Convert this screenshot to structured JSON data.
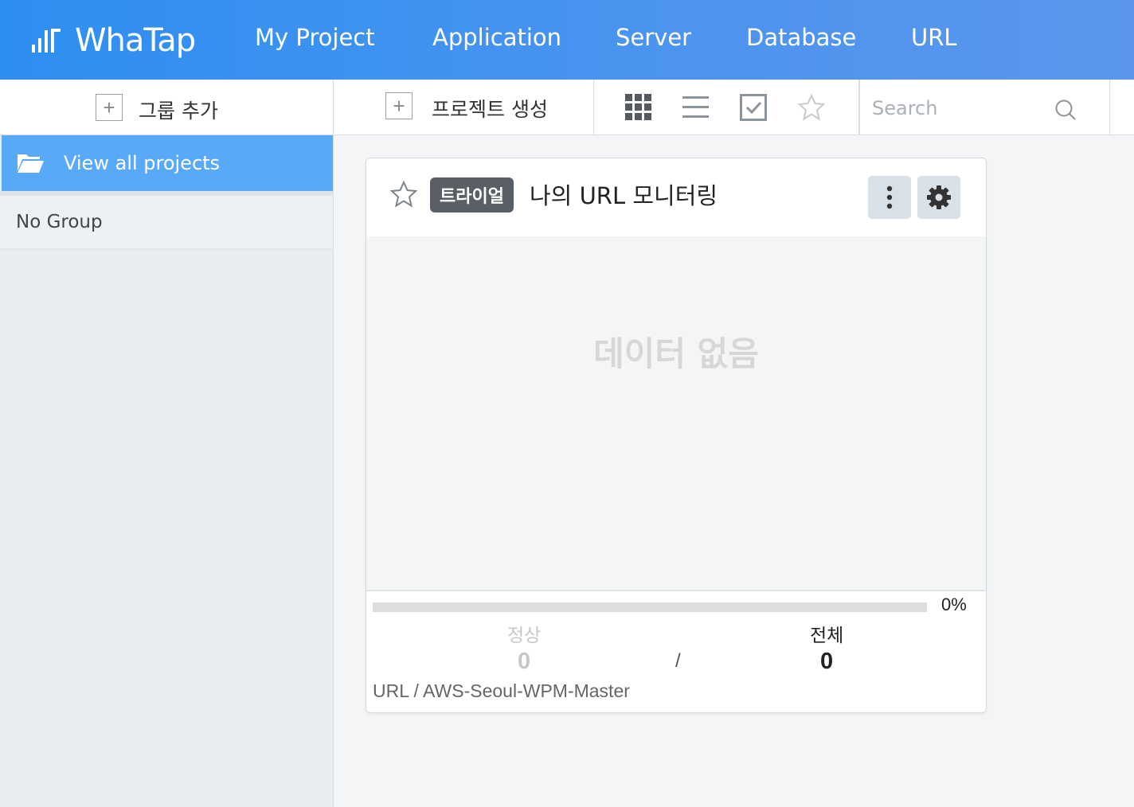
{
  "brand": {
    "name": "WhaTap"
  },
  "nav": {
    "items": [
      {
        "label": "My Project"
      },
      {
        "label": "Application"
      },
      {
        "label": "Server"
      },
      {
        "label": "Database"
      },
      {
        "label": "URL"
      }
    ]
  },
  "toolbar": {
    "add_group_label": "그룹 추가",
    "create_project_label": "프로젝트 생성",
    "view_modes": [
      "grid-view",
      "list-view",
      "checklist-view",
      "favorites-view"
    ],
    "search_placeholder": "Search"
  },
  "sidebar": {
    "active_item": {
      "label": "View all projects",
      "icon": "folder-open-icon"
    },
    "items": [
      {
        "label": "No Group"
      }
    ]
  },
  "project_card": {
    "badge": "트라이얼",
    "title": "나의 URL 모니터링",
    "empty_message": "데이터 없음",
    "progress_percent": 0,
    "progress_label": "0%",
    "normal_label": "정상",
    "normal_count": "0",
    "separator": "/",
    "total_label": "전체",
    "total_count": "0",
    "path": "URL / AWS-Seoul-WPM-Master"
  },
  "colors": {
    "header_blue": "#2d8ff0",
    "active_sidebar": "#58a9f8",
    "badge_bg": "#5a5f66"
  }
}
